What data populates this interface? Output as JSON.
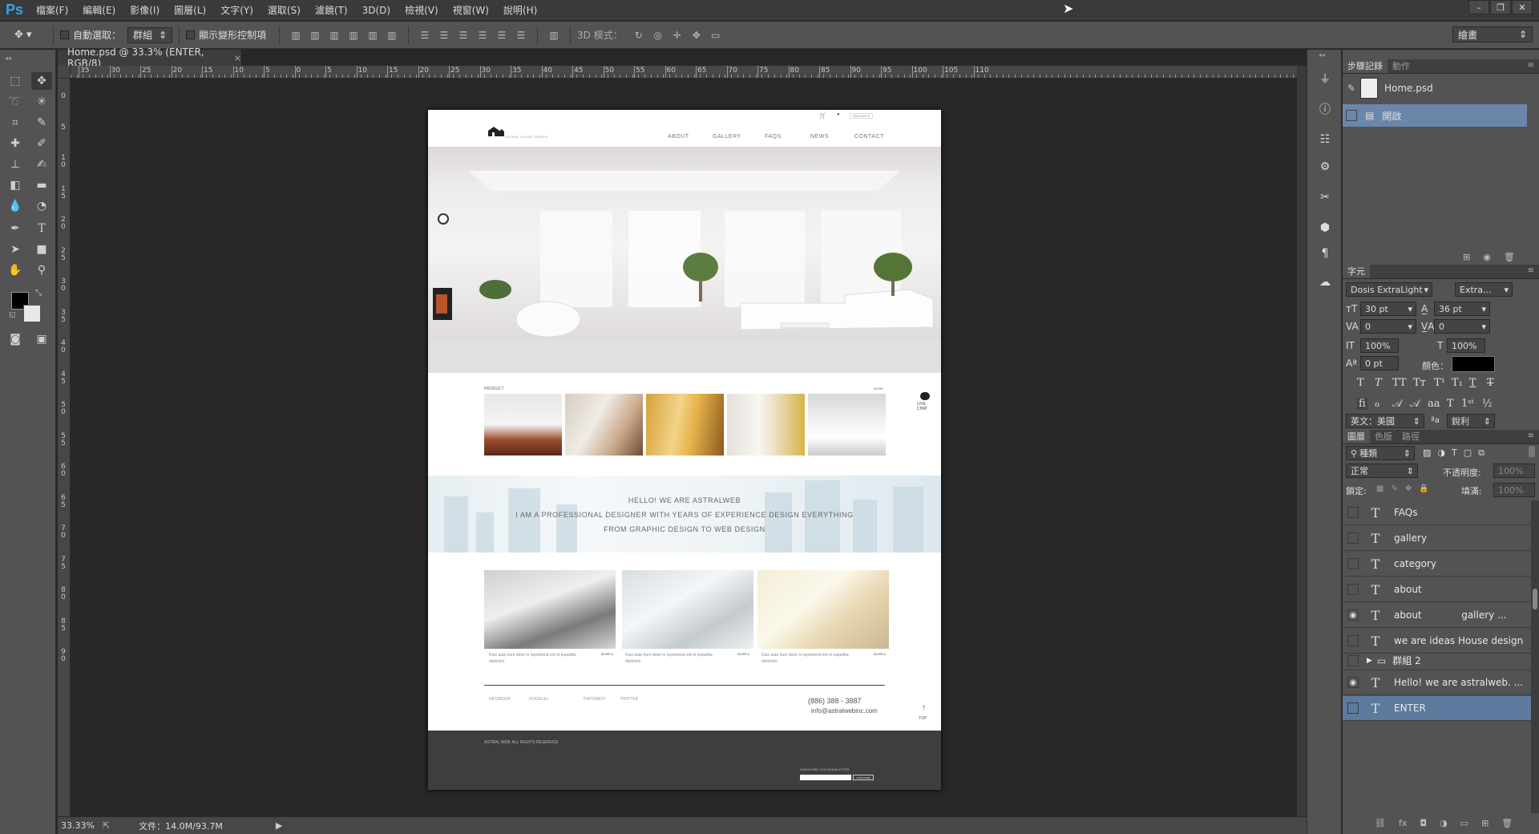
{
  "app": {
    "logo": "Ps",
    "menu": [
      "檔案(F)",
      "編輯(E)",
      "影像(I)",
      "圖層(L)",
      "文字(Y)",
      "選取(S)",
      "濾鏡(T)",
      "3D(D)",
      "檢視(V)",
      "視窗(W)",
      "說明(H)"
    ],
    "window_controls": [
      "–",
      "❐",
      "✕"
    ]
  },
  "options": {
    "auto_select_label": "自動選取：",
    "auto_select_value": "群組",
    "show_transform_label": "顯示變形控制項",
    "mode_3d_label": "3D 模式：",
    "workspace": "繪畫"
  },
  "document": {
    "tab_title": "Home.psd @ 33.3% (ENTER, RGB/8)",
    "close": "×"
  },
  "ruler": {
    "top_labels": [
      "5",
      "0",
      "5",
      "10",
      "15",
      "20",
      "25",
      "30",
      "35",
      "40",
      "45",
      "50",
      "55",
      "60",
      "65",
      "70",
      "75",
      "80",
      "85",
      "90",
      "95",
      "100",
      "105",
      "110"
    ],
    "top_labels_left": [
      "35",
      "30",
      "25",
      "20",
      "15",
      "10",
      "5",
      "0"
    ],
    "left_labels": [
      "0",
      "5",
      "1\n0",
      "1\n5",
      "2\n0",
      "2\n5",
      "3\n0",
      "3\n5",
      "4\n0",
      "4\n5",
      "5\n0",
      "5\n5",
      "6\n0",
      "6\n5",
      "7\n0",
      "7\n5",
      "8\n0",
      "8\n5",
      "9\n0"
    ]
  },
  "status": {
    "zoom": "33.33%",
    "doc_size": "文件：14.0M/93.7M"
  },
  "design": {
    "nav": [
      "ABOUT",
      "GALLERY",
      "FAQS",
      "NEWS",
      "CONTACT"
    ],
    "logo_text": "ASTRAL HOUSE DESIGN",
    "lang": "ENGLISH ▾",
    "product_label": "PRODUCT",
    "more_label": "MORE",
    "live_chat": "LIVE\nCHAT",
    "banner_lines": [
      "HELLO! WE ARE ASTRALWEB",
      "I AM A PROFESSIONAL DESIGNER WITH YEARS OF EXPERIENCE DESIGN EVERYTHING",
      "FROM GRAPHIC DESIGN  TO WEB DESIGN"
    ],
    "card_text": "Duis aute irure dolor in reprehend erit et expedita distinctio",
    "card_more": "MORE ▸",
    "social": [
      "FACEBOOK",
      "GOOGLE+",
      "PINTEREST",
      "TWITTER"
    ],
    "phone": "(886) 388 - 3887",
    "email": "info@astralwebinc.com",
    "top": "TOP",
    "copyright": "ASTRAL WEB. ALL RIGHTS RESERVED",
    "subscribe": "SUBSCRIBE OUR NEWSLETTER",
    "subscribe_btn": "SUBSCRIBE"
  },
  "panels": {
    "history_tabs": [
      "步驟記錄",
      "動作"
    ],
    "history_items": [
      "Home.psd",
      "開啟"
    ],
    "char_tab": "字元",
    "font_family": "Dosis ExtraLight",
    "font_style": "Extra...",
    "font_size": "30 pt",
    "leading": "36 pt",
    "kerning": "0",
    "tracking": "0",
    "vscale": "100%",
    "hscale": "100%",
    "baseline": "0 pt",
    "color_label": "顏色：",
    "language": "英文：美國",
    "aa_label": "ªa",
    "aa_value": "銳利",
    "layers_tabs": [
      "圖層",
      "色版",
      "路徑"
    ],
    "filter_kind": "種類",
    "blend_mode": "正常",
    "opacity_label": "不透明度:",
    "opacity_value": "100%",
    "lock_label": "鎖定:",
    "fill_label": "填滿:",
    "fill_value": "100%",
    "layers": [
      {
        "name": "FAQs",
        "visible": false,
        "type": "text"
      },
      {
        "name": "gallery",
        "visible": false,
        "type": "text"
      },
      {
        "name": "category",
        "visible": false,
        "type": "text"
      },
      {
        "name": "about",
        "visible": false,
        "type": "text"
      },
      {
        "name": "about             gallery ...",
        "visible": true,
        "type": "text"
      },
      {
        "name": "we are ideas House design",
        "visible": false,
        "type": "text"
      },
      {
        "name": "群組 2",
        "visible": false,
        "type": "group"
      },
      {
        "name": "Hello! we are astralweb. ...",
        "visible": true,
        "type": "text"
      },
      {
        "name": "ENTER",
        "visible": false,
        "type": "text",
        "selected": true
      }
    ]
  },
  "colors": {
    "accent": "#3ba2e8",
    "selected_layer": "#5d7a9e",
    "panel_bg": "#535353",
    "canvas_bg": "#282828"
  }
}
